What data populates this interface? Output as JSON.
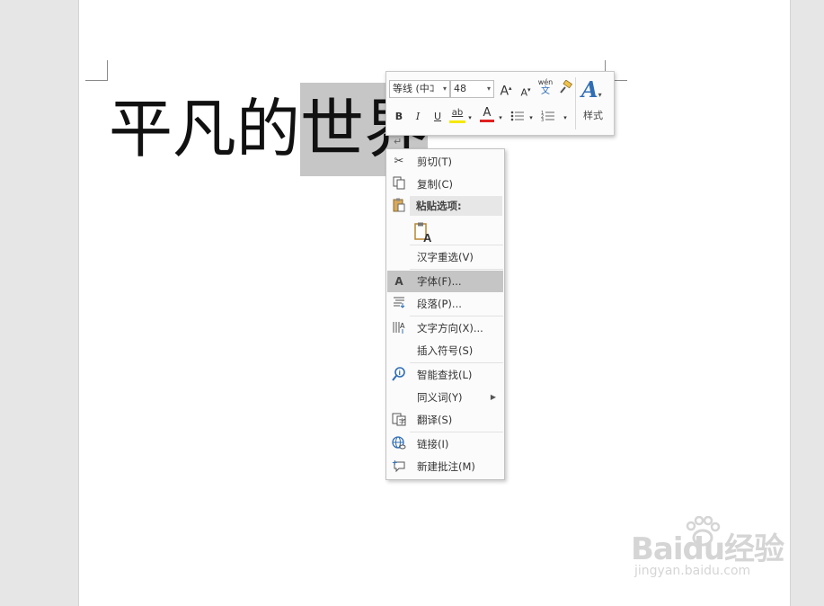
{
  "document": {
    "text_before": "平凡的",
    "text_selected": "世界",
    "paragraph_mark": "↵"
  },
  "mini_toolbar": {
    "font_name": "等线 (中ｺ",
    "font_size": "48",
    "grow_font": "A",
    "shrink_font": "A",
    "phonetic_top": "wén",
    "phonetic_bottom": "文",
    "bold": "B",
    "italic": "I",
    "underline": "U",
    "highlight": "ab",
    "font_color": "A",
    "styles_label": "样式",
    "highlight_color": "#f5e800",
    "font_color_value": "#e02020"
  },
  "context_menu": {
    "items": [
      {
        "icon": "scissors-icon",
        "label": "剪切(T)"
      },
      {
        "icon": "copy-icon",
        "label": "复制(C)"
      },
      {
        "icon": "paste-icon",
        "label": "粘贴选项:"
      },
      {
        "icon": "paste-keep-text-icon",
        "label": ""
      },
      {
        "icon": "",
        "label": "汉字重选(V)"
      },
      {
        "icon": "font-icon",
        "label": "字体(F)..."
      },
      {
        "icon": "paragraph-icon",
        "label": "段落(P)..."
      },
      {
        "icon": "text-direction-icon",
        "label": "文字方向(X)..."
      },
      {
        "icon": "",
        "label": "插入符号(S)"
      },
      {
        "icon": "smart-lookup-icon",
        "label": "智能查找(L)"
      },
      {
        "icon": "",
        "label": "同义词(Y)"
      },
      {
        "icon": "translate-icon",
        "label": "翻译(S)"
      },
      {
        "icon": "link-icon",
        "label": "链接(I)"
      },
      {
        "icon": "new-comment-icon",
        "label": "新建批注(M)"
      }
    ],
    "highlighted_index": 5
  },
  "watermark": {
    "brand_text": "Baidu经验",
    "url_text": "jingyan.baidu.com"
  }
}
